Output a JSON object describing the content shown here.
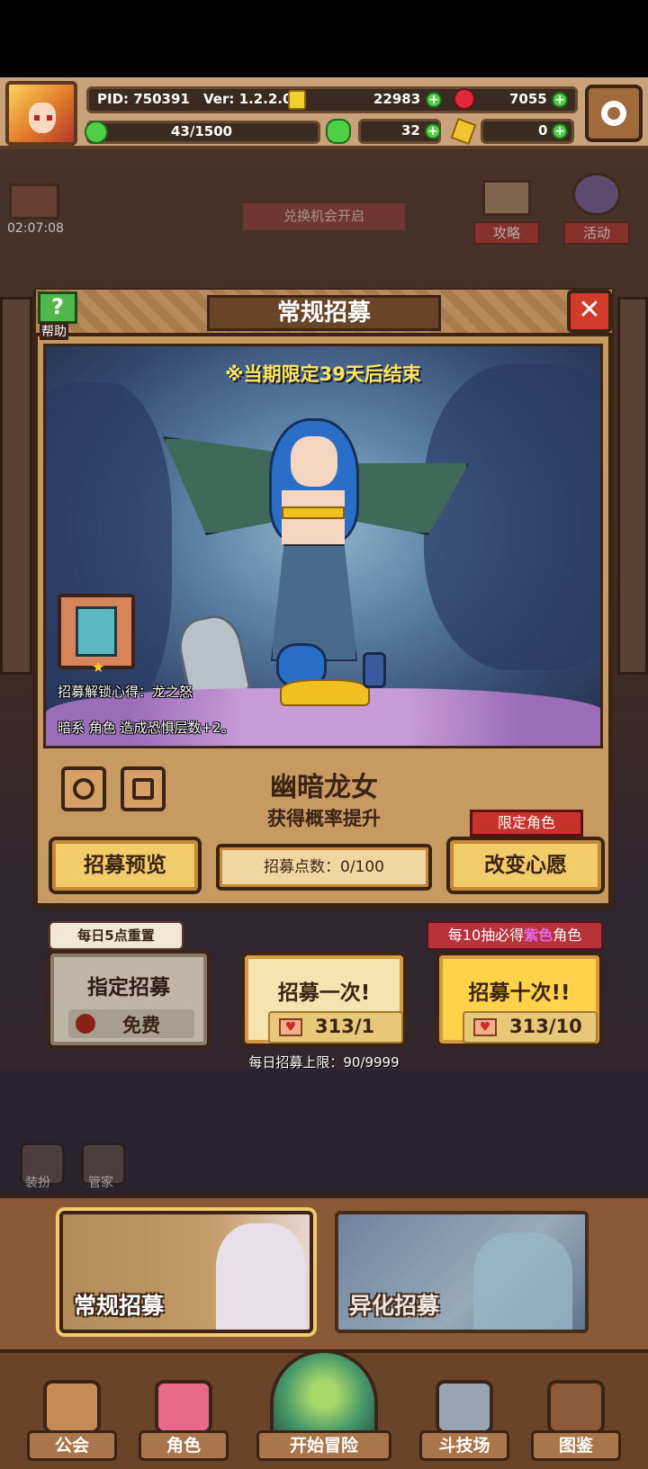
{
  "topbar": {
    "pid": "PID: 750391",
    "version": "Ver: 1.2.2.0",
    "exp": "43/1500",
    "gold": "22983",
    "gems": "7055",
    "clover": "32",
    "tickets": "0"
  },
  "side": {
    "timer": "02:07:08",
    "exchange_banner": "兑换机会开启",
    "guide_label": "攻略",
    "event_label": "活动",
    "outfit_label": "装扮",
    "butler_label": "管家"
  },
  "dialog": {
    "title": "常规招募",
    "help_label": "帮助",
    "close": "✕",
    "limit_notice": "※当期限定39天后结束",
    "unlock_line1": "招募解锁心得：龙之怒",
    "unlock_line2": "暗系 角色 造成恐惧层数+2。",
    "character_name": "幽暗龙女",
    "rate_up": "获得概率提升",
    "preview_button": "招募预览",
    "points": "招募点数：0/100",
    "limited_tag": "限定角色",
    "wish_button": "改变心愿"
  },
  "recruit": {
    "daily_reset_tag": "每日5点重置",
    "assign_title": "指定招募",
    "assign_cost": "免费",
    "once_title": "招募一次!",
    "once_cost": "313/1",
    "ten_tag_pre": "每10抽必得",
    "ten_tag_color": "紫色",
    "ten_tag_post": "角色",
    "ten_title": "招募十次!!",
    "ten_cost": "313/10",
    "daily_limit": "每日招募上限：90/9999"
  },
  "pools": {
    "normal": "常规招募",
    "alternate": "异化招募"
  },
  "nav": {
    "guild": "公会",
    "character": "角色",
    "adventure": "开始冒险",
    "arena": "斗技场",
    "codex": "图鉴"
  }
}
